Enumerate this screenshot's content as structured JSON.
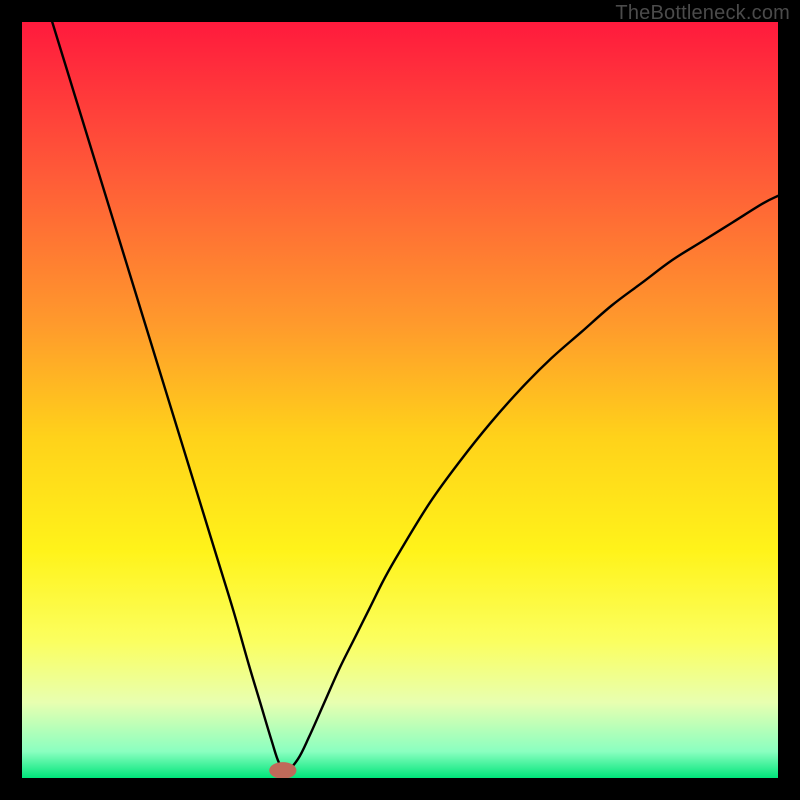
{
  "watermark": "TheBottleneck.com",
  "chart_data": {
    "type": "line",
    "title": "",
    "xlabel": "",
    "ylabel": "",
    "xlim": [
      0,
      100
    ],
    "ylim": [
      0,
      100
    ],
    "grid": false,
    "legend": false,
    "note": "Axes have no visible tick labels; values are read as percentages of plotting area. Curve values estimated from pixel positions.",
    "gradient_stops": [
      {
        "offset": 0.0,
        "color": "#ff1a3d"
      },
      {
        "offset": 0.2,
        "color": "#ff5a38"
      },
      {
        "offset": 0.4,
        "color": "#ff9a2c"
      },
      {
        "offset": 0.55,
        "color": "#ffd21a"
      },
      {
        "offset": 0.7,
        "color": "#fff31a"
      },
      {
        "offset": 0.82,
        "color": "#fbff60"
      },
      {
        "offset": 0.9,
        "color": "#e8ffb0"
      },
      {
        "offset": 0.965,
        "color": "#8affc0"
      },
      {
        "offset": 1.0,
        "color": "#00e57a"
      }
    ],
    "marker": {
      "x": 34.5,
      "y": 1.0,
      "color": "#bf6a5a",
      "rx": 1.8,
      "ry": 1.1
    },
    "series": [
      {
        "name": "bottleneck-curve",
        "x": [
          4,
          6,
          8,
          10,
          12,
          14,
          16,
          18,
          20,
          22,
          24,
          26,
          28,
          30,
          31.5,
          33,
          34,
          35,
          36.5,
          38,
          40,
          42,
          44,
          46,
          48,
          50,
          54,
          58,
          62,
          66,
          70,
          74,
          78,
          82,
          86,
          90,
          94,
          98,
          100
        ],
        "y": [
          100,
          93.5,
          87,
          80.5,
          74,
          67.5,
          61,
          54.5,
          48,
          41.5,
          35,
          28.5,
          22,
          15,
          10,
          5,
          2,
          1,
          2.5,
          5.5,
          10,
          14.5,
          18.5,
          22.5,
          26.5,
          30,
          36.5,
          42,
          47,
          51.5,
          55.5,
          59,
          62.5,
          65.5,
          68.5,
          71,
          73.5,
          76,
          77
        ]
      }
    ]
  }
}
